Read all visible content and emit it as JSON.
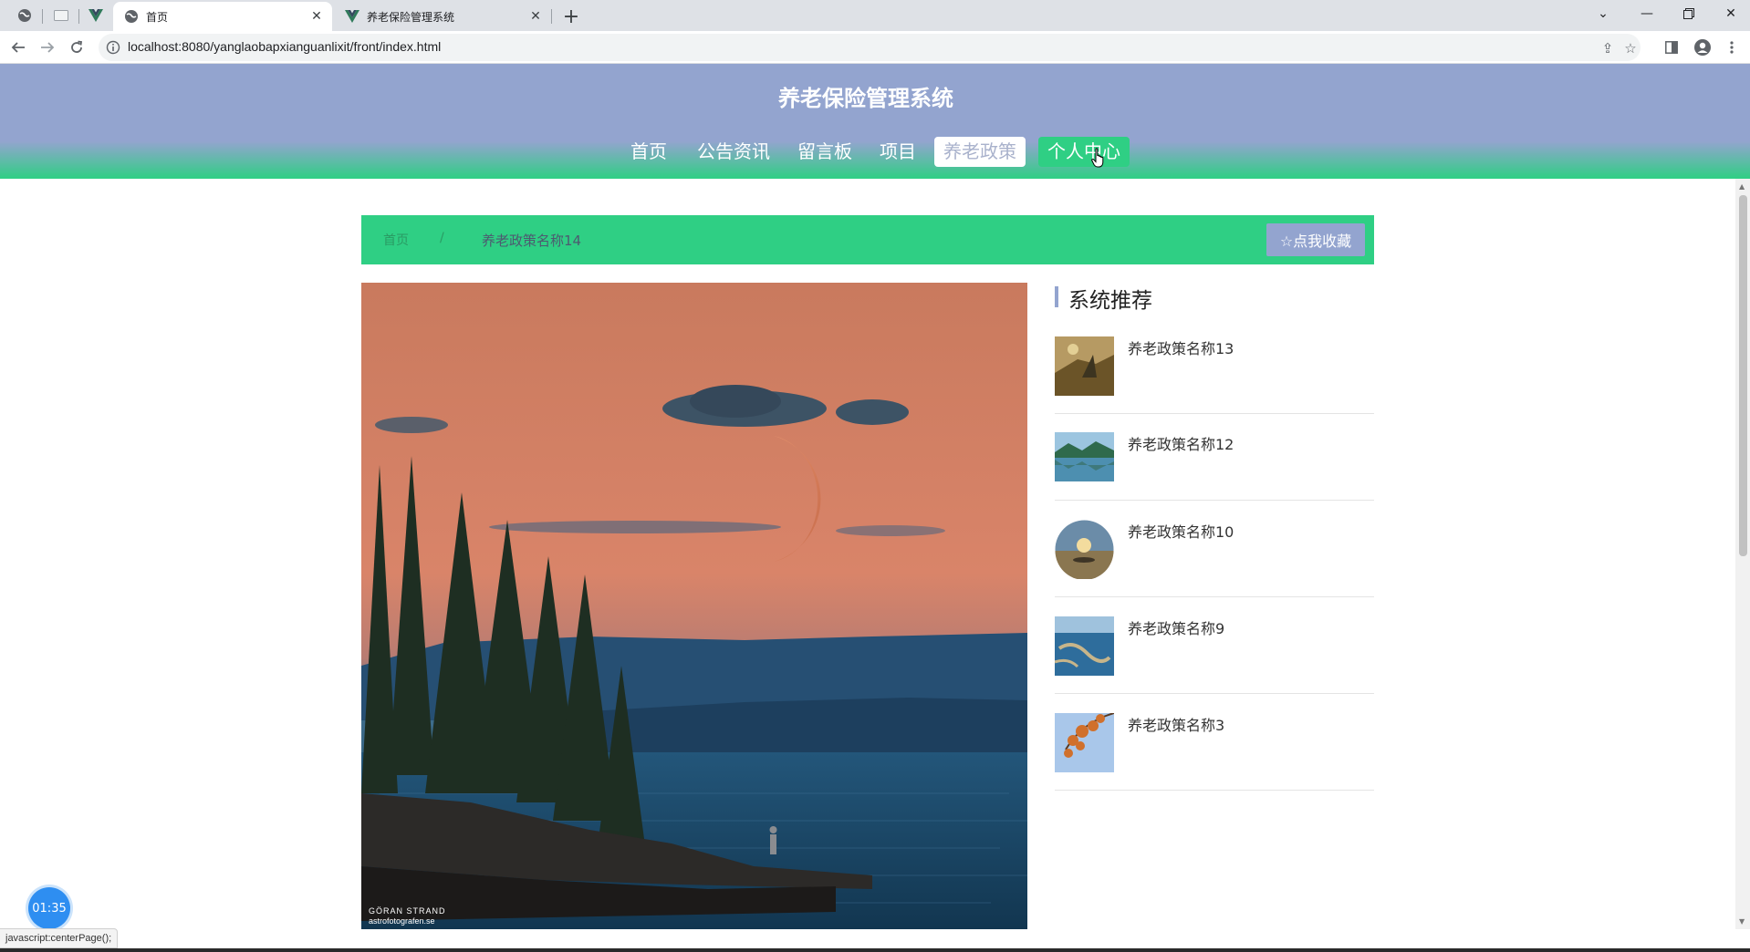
{
  "browser": {
    "tabs": [
      {
        "title": "首页",
        "active": true
      },
      {
        "title": "养老保险管理系统",
        "active": false
      }
    ],
    "url": "localhost:8080/yanglaobapxianguanlixit/front/index.html",
    "status_text": "javascript:centerPage();"
  },
  "site": {
    "title": "养老保险管理系统",
    "nav": [
      {
        "label": "首页"
      },
      {
        "label": "公告资讯"
      },
      {
        "label": "留言板"
      },
      {
        "label": "项目"
      },
      {
        "label": "养老政策",
        "active": true
      },
      {
        "label": "个人中心",
        "hover": true
      }
    ]
  },
  "breadcrumb": {
    "home": "首页",
    "separator": "/",
    "current": "养老政策名称14"
  },
  "favorite_button": "☆点我收藏",
  "recommend": {
    "title": "系统推荐",
    "items": [
      {
        "name": "养老政策名称13"
      },
      {
        "name": "养老政策名称12"
      },
      {
        "name": "养老政策名称10"
      },
      {
        "name": "养老政策名称9"
      },
      {
        "name": "养老政策名称3"
      }
    ]
  },
  "hero_image": {
    "credit_line1": "GÖRAN STRAND",
    "credit_line2": "astrofotografen.se"
  },
  "timer": "01:35",
  "colors": {
    "header_blue": "#93a4cf",
    "accent_green": "#2fcf84"
  }
}
